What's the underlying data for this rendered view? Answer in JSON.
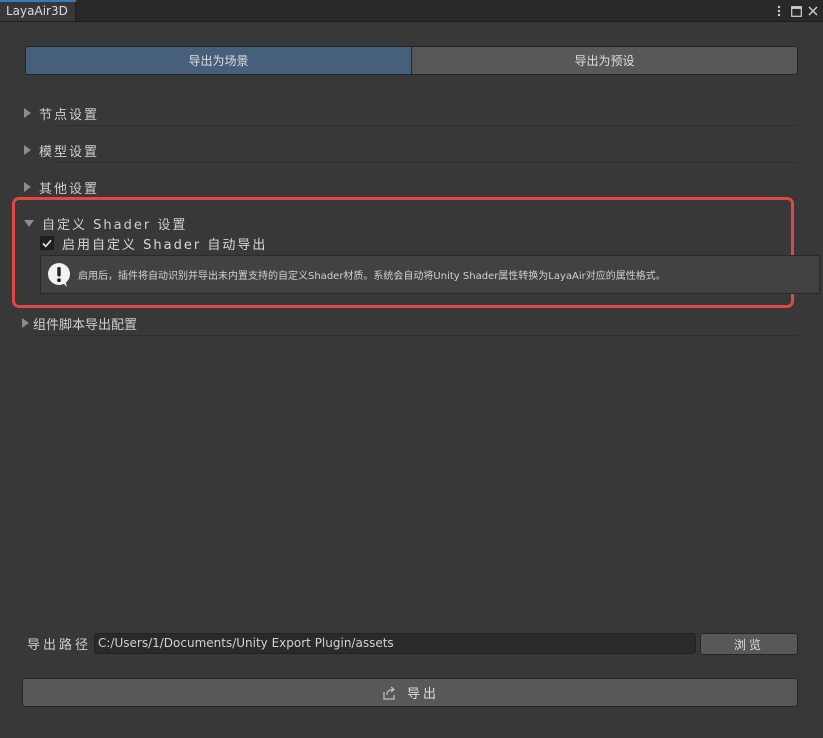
{
  "window": {
    "tab_title": "LayaAir3D",
    "icons": [
      "menu-dots-icon",
      "maximize-icon",
      "close-icon"
    ]
  },
  "export_mode": {
    "scene_label": "导出为场景",
    "prefab_label": "导出为预设",
    "selected": "scene"
  },
  "sections": {
    "node_settings": "节点设置",
    "model_settings": "模型设置",
    "other_settings": "其他设置",
    "custom_shader": {
      "title": "自定义 Shader 设置",
      "enable_label": "启用自定义 Shader 自动导出",
      "enable_checked": true,
      "help_text": "启用后，插件将自动识别并导出未内置支持的自定义Shader材质。系统会自动将Unity Shader属性转换为LayaAir对应的属性格式。"
    },
    "component_script": "组件脚本导出配置"
  },
  "output": {
    "path_label": "导出路径",
    "path_value": "C:/Users/1/Documents/Unity Export Plugin/assets",
    "browse_label": "浏览",
    "export_label": "导出"
  },
  "colors": {
    "background": "#383838",
    "active_segment": "#46607c",
    "highlight_border": "#e04848"
  }
}
